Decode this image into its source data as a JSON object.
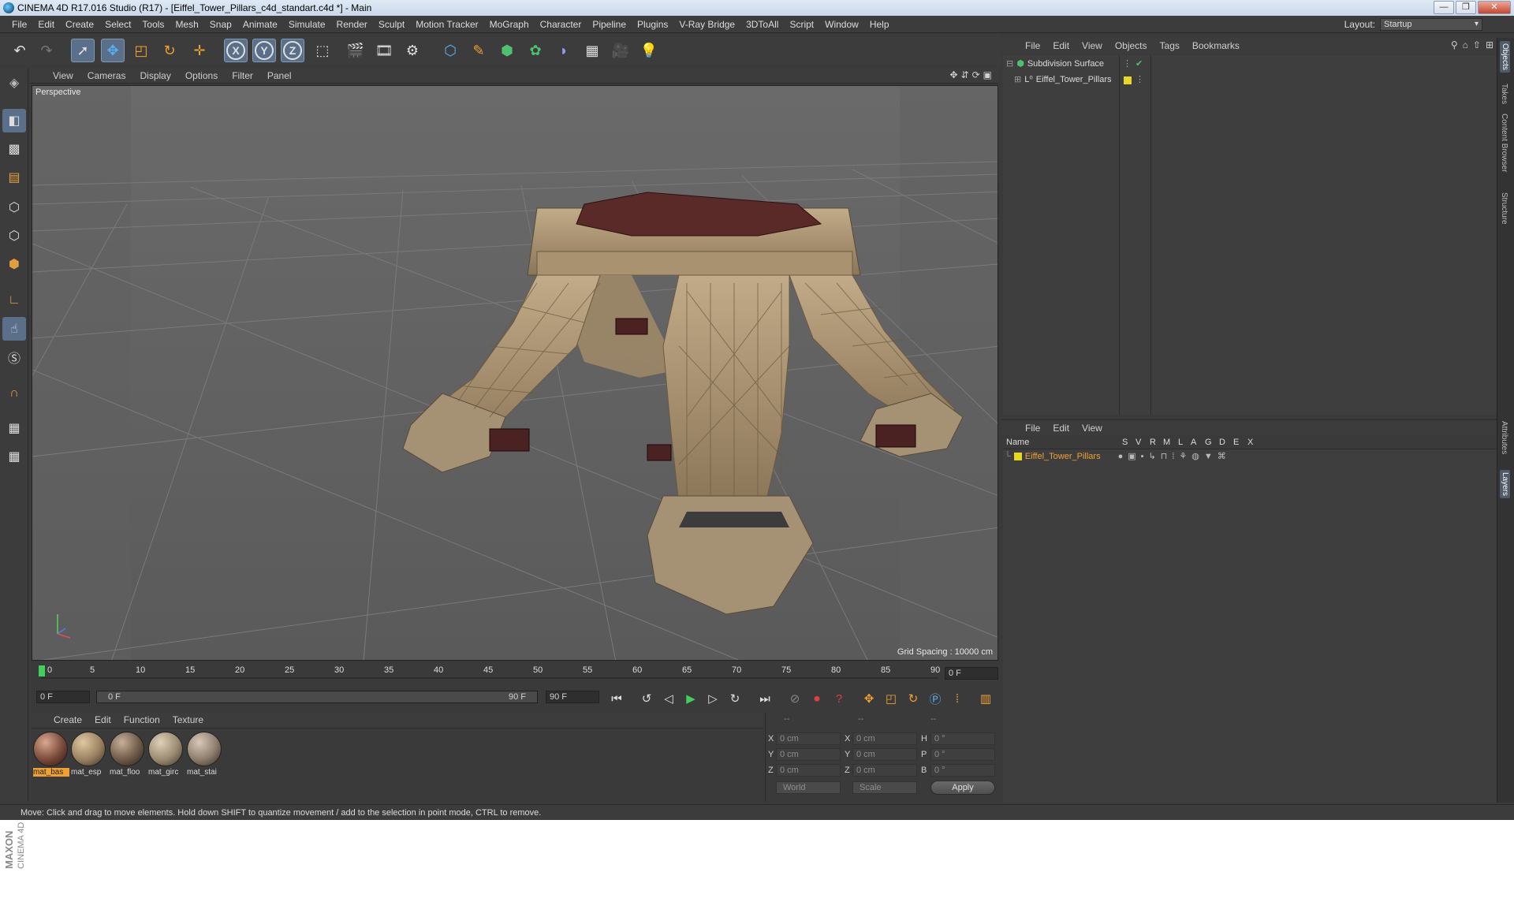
{
  "window": {
    "title": "CINEMA 4D R17.016 Studio (R17) - [Eiffel_Tower_Pillars_c4d_standart.c4d *] - Main",
    "buttons": [
      "—",
      "❐",
      "✕"
    ]
  },
  "menubar": [
    "File",
    "Edit",
    "Create",
    "Select",
    "Tools",
    "Mesh",
    "Snap",
    "Animate",
    "Simulate",
    "Render",
    "Sculpt",
    "Motion Tracker",
    "MoGraph",
    "Character",
    "Pipeline",
    "Plugins",
    "V-Ray Bridge",
    "3DToAll",
    "Script",
    "Window",
    "Help"
  ],
  "layout": {
    "label": "Layout:",
    "value": "Startup"
  },
  "toolbar": {
    "axis_x": "X",
    "axis_y": "Y",
    "axis_z": "Z"
  },
  "viewport": {
    "menu": [
      "View",
      "Cameras",
      "Display",
      "Options",
      "Filter",
      "Panel"
    ],
    "label": "Perspective",
    "grid_spacing": "Grid Spacing : 10000 cm"
  },
  "timeline": {
    "ticks": [
      "0",
      "5",
      "10",
      "15",
      "20",
      "25",
      "30",
      "35",
      "40",
      "45",
      "50",
      "55",
      "60",
      "65",
      "70",
      "75",
      "80",
      "85",
      "90"
    ],
    "current_frame": "0 F",
    "start_field": "0 F",
    "range_start": "0 F",
    "range_end": "90 F",
    "end_field": "90 F"
  },
  "materials": {
    "menu": [
      "Create",
      "Edit",
      "Function",
      "Texture"
    ],
    "items": [
      {
        "label": "mat_bas",
        "selected": true,
        "color": "#7a4a3a"
      },
      {
        "label": "mat_esp",
        "selected": false,
        "color": "#9a8060"
      },
      {
        "label": "mat_floo",
        "selected": false,
        "color": "#6e5a48"
      },
      {
        "label": "mat_girc",
        "selected": false,
        "color": "#9b8a72"
      },
      {
        "label": "mat_stai",
        "selected": false,
        "color": "#8c7d6c"
      }
    ]
  },
  "coordinates": {
    "header": [
      "--",
      "--",
      "--"
    ],
    "rows": [
      {
        "a": "X",
        "av": "0 cm",
        "b": "X",
        "bv": "0 cm",
        "c": "H",
        "cv": "0 °"
      },
      {
        "a": "Y",
        "av": "0 cm",
        "b": "Y",
        "bv": "0 cm",
        "c": "P",
        "cv": "0 °"
      },
      {
        "a": "Z",
        "av": "0 cm",
        "b": "Z",
        "bv": "0 cm",
        "c": "B",
        "cv": "0 °"
      }
    ],
    "space": "World",
    "mode": "Scale",
    "apply": "Apply"
  },
  "status": "Move: Click and drag to move elements. Hold down SHIFT to quantize movement / add to the selection in point mode, CTRL to remove.",
  "objects": {
    "menu": [
      "File",
      "Edit",
      "View",
      "Objects",
      "Tags",
      "Bookmarks"
    ],
    "items": [
      {
        "name": "Subdivision Surface"
      },
      {
        "name": "Eiffel_Tower_Pillars"
      }
    ]
  },
  "layers": {
    "menu": [
      "File",
      "Edit",
      "View"
    ],
    "columns": [
      "Name",
      "S",
      "V",
      "R",
      "M",
      "L",
      "A",
      "G",
      "D",
      "E",
      "X"
    ],
    "row": "Eiffel_Tower_Pillars"
  },
  "right_tabs": [
    "Objects",
    "Takes",
    "Content Browser",
    "Structure",
    "Attributes",
    "Layers"
  ],
  "branding": {
    "logo": "MAXON CINEMA 4D"
  },
  "colors": {
    "accent": "#f0a030",
    "panel": "#3c3c3c",
    "selected_tool": "#5a6f8a"
  }
}
